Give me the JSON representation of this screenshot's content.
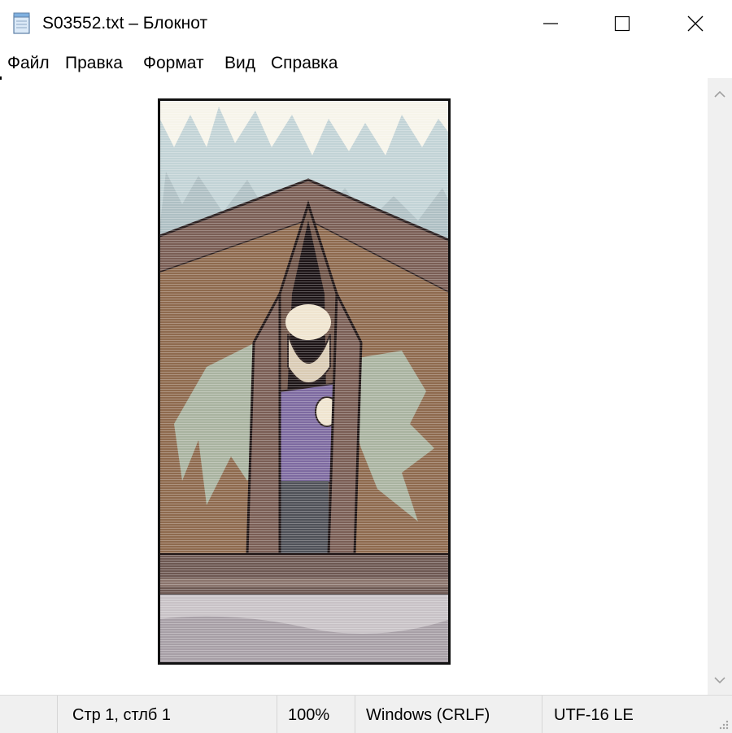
{
  "window": {
    "title": "S03552.txt – Блокнот"
  },
  "menu": {
    "items": [
      "Файл",
      "Правка",
      "Формат",
      "Вид",
      "Справка"
    ]
  },
  "editor": {
    "content_type": "ascii-art picture of a man peeking out of a tent"
  },
  "status": {
    "position": "Стр 1, стлб 1",
    "zoom": "100%",
    "line_endings": "Windows (CRLF)",
    "encoding": "UTF-16 LE"
  },
  "colors": {
    "sky": "#c2d3d6",
    "tent": "#7a5e55",
    "tent_dark": "#4a3634",
    "canvas": "#8e6a4e",
    "grass": "#a9b3a0",
    "shirt": "#7d6aa0",
    "skin": "#efe4cf"
  }
}
